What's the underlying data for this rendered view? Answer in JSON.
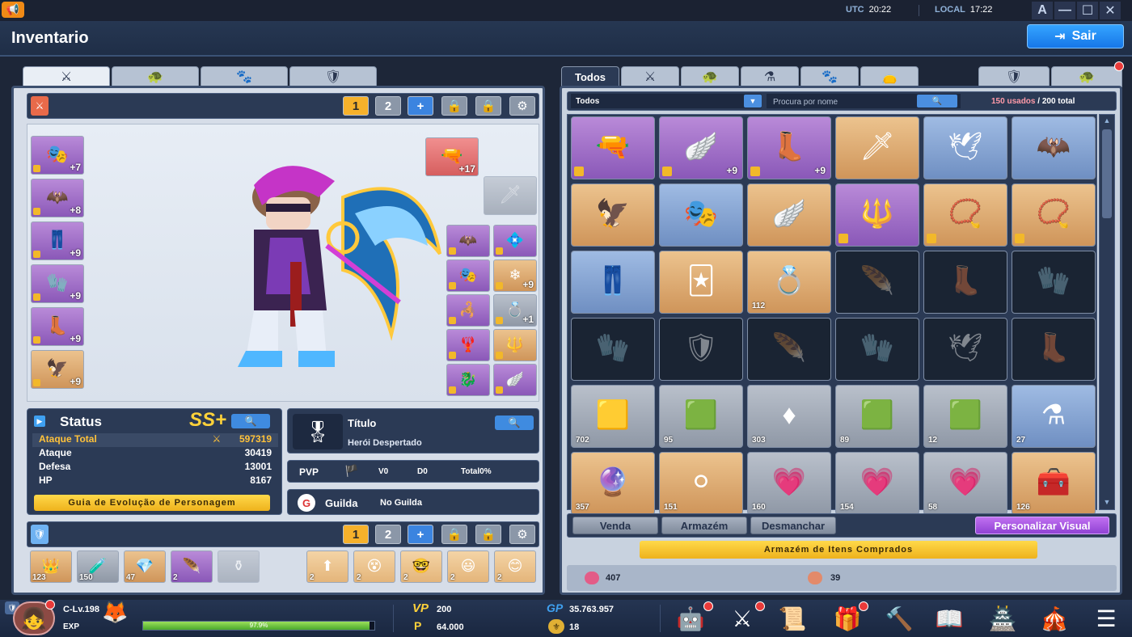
{
  "system": {
    "utc_label": "UTC",
    "utc_time": "20:22",
    "local_label": "LOCAL",
    "local_time": "17:22",
    "font_btn": "A",
    "min_btn": "—",
    "max_btn": "☐",
    "close_btn": "✕"
  },
  "header": {
    "title": "Inventario",
    "exit_label": "Sair"
  },
  "left": {
    "tabs": [
      "sword-icon",
      "armor-icon",
      "paw-icon",
      "shield-icon"
    ],
    "pages": [
      "1",
      "2"
    ],
    "add": "+",
    "left_slots": [
      {
        "lv": "+7",
        "tint": "purple",
        "icon": "🎭"
      },
      {
        "lv": "+8",
        "tint": "purple",
        "icon": "🦇"
      },
      {
        "lv": "+9",
        "tint": "purple",
        "icon": "👖"
      },
      {
        "lv": "+9",
        "tint": "purple",
        "icon": "🧤"
      },
      {
        "lv": "+9",
        "tint": "purple",
        "icon": "👢"
      },
      {
        "lv": "+9",
        "tint": "orange",
        "icon": "🦅"
      }
    ],
    "weapon_lv": "+17",
    "right_slots": [
      {
        "lv": "",
        "tint": "purple",
        "icon": "🦇"
      },
      {
        "lv": "",
        "tint": "purple",
        "icon": "💠"
      },
      {
        "lv": "",
        "tint": "purple",
        "icon": "🎭"
      },
      {
        "lv": "+9",
        "tint": "orange",
        "icon": "❄"
      },
      {
        "lv": "",
        "tint": "purple",
        "icon": "🦂"
      },
      {
        "lv": "+1",
        "tint": "gray",
        "icon": "💍"
      },
      {
        "lv": "",
        "tint": "purple",
        "icon": "🦞"
      },
      {
        "lv": "",
        "tint": "orange",
        "icon": "🔱"
      },
      {
        "lv": "",
        "tint": "purple",
        "icon": "🐉"
      },
      {
        "lv": "",
        "tint": "purple",
        "icon": "🪽"
      }
    ],
    "status": {
      "title": "Status",
      "grade": "SS+",
      "rows": [
        {
          "label": "Ataque Total",
          "value": "597319"
        },
        {
          "label": "Ataque",
          "value": "30419"
        },
        {
          "label": "Defesa",
          "value": "13001"
        },
        {
          "label": "HP",
          "value": "8167"
        }
      ],
      "guide_btn": "Guia de Evolução de Personagem"
    },
    "title_box": {
      "label": "Título",
      "value": "Herói Despertado"
    },
    "pvp": {
      "label": "PVP",
      "v": "V0",
      "d": "D0",
      "total": "Total0%"
    },
    "guild": {
      "label": "Guilda",
      "value": "No Guilda"
    },
    "quick_items": [
      {
        "count": "123",
        "tint": "orange",
        "icon": "👑"
      },
      {
        "count": "150",
        "tint": "gray",
        "icon": "🧪"
      },
      {
        "count": "47",
        "tint": "orange",
        "icon": "💎"
      },
      {
        "count": "2",
        "tint": "purple",
        "icon": "🪶"
      }
    ],
    "emotes": [
      {
        "count": "2",
        "icon": "⬆"
      },
      {
        "count": "2",
        "icon": "😵"
      },
      {
        "count": "2",
        "icon": "🤓"
      },
      {
        "count": "2",
        "icon": "😃"
      },
      {
        "count": "2",
        "icon": "😊"
      }
    ]
  },
  "right": {
    "tab_all": "Todos",
    "filter": "Todos",
    "search_placeholder": "Procura por nome",
    "used": "150 usados",
    "total": "/ 200 total",
    "grid": [
      {
        "tint": "purple",
        "icon": "🔫",
        "lock": true,
        "plus": "",
        "cnt": ""
      },
      {
        "tint": "purple",
        "icon": "🪽",
        "lock": true,
        "plus": "+9",
        "cnt": ""
      },
      {
        "tint": "purple",
        "icon": "👢",
        "lock": true,
        "plus": "+9",
        "cnt": ""
      },
      {
        "tint": "orange",
        "icon": "🗡",
        "lock": false,
        "plus": "",
        "cnt": ""
      },
      {
        "tint": "blue",
        "icon": "🕊",
        "lock": false,
        "plus": "",
        "cnt": ""
      },
      {
        "tint": "blue",
        "icon": "🦇",
        "lock": false,
        "plus": "",
        "cnt": ""
      },
      {
        "tint": "orange",
        "icon": "🦅",
        "lock": false,
        "plus": "",
        "cnt": ""
      },
      {
        "tint": "blue",
        "icon": "🎭",
        "lock": false,
        "plus": "",
        "cnt": ""
      },
      {
        "tint": "orange",
        "icon": "🪽",
        "lock": false,
        "plus": "",
        "cnt": ""
      },
      {
        "tint": "purple",
        "icon": "🔱",
        "lock": true,
        "plus": "",
        "cnt": ""
      },
      {
        "tint": "orange",
        "icon": "📿",
        "lock": true,
        "plus": "",
        "cnt": ""
      },
      {
        "tint": "orange",
        "icon": "📿",
        "lock": true,
        "plus": "",
        "cnt": ""
      },
      {
        "tint": "blue",
        "icon": "👖",
        "lock": false,
        "plus": "",
        "cnt": ""
      },
      {
        "tint": "orange",
        "icon": "🃏",
        "lock": false,
        "plus": "",
        "cnt": ""
      },
      {
        "tint": "orange",
        "icon": "💍",
        "lock": false,
        "plus": "",
        "cnt": "112"
      },
      {
        "tint": "dark",
        "icon": "🪶",
        "lock": false,
        "plus": "",
        "cnt": ""
      },
      {
        "tint": "dark",
        "icon": "👢",
        "lock": false,
        "plus": "",
        "cnt": ""
      },
      {
        "tint": "dark",
        "icon": "🧤",
        "lock": false,
        "plus": "",
        "cnt": ""
      },
      {
        "tint": "dark",
        "icon": "🧤",
        "lock": false,
        "plus": "",
        "cnt": ""
      },
      {
        "tint": "dark",
        "icon": "🛡",
        "lock": false,
        "plus": "",
        "cnt": ""
      },
      {
        "tint": "dark",
        "icon": "🪶",
        "lock": false,
        "plus": "",
        "cnt": ""
      },
      {
        "tint": "dark",
        "icon": "🧤",
        "lock": false,
        "plus": "",
        "cnt": ""
      },
      {
        "tint": "dark",
        "icon": "🕊",
        "lock": false,
        "plus": "",
        "cnt": ""
      },
      {
        "tint": "dark",
        "icon": "👢",
        "lock": false,
        "plus": "",
        "cnt": ""
      },
      {
        "tint": "gray",
        "icon": "🟨",
        "lock": false,
        "plus": "",
        "cnt": "702"
      },
      {
        "tint": "gray",
        "icon": "🟩",
        "lock": false,
        "plus": "",
        "cnt": "95"
      },
      {
        "tint": "gray",
        "icon": "♦",
        "lock": false,
        "plus": "",
        "cnt": "303"
      },
      {
        "tint": "gray",
        "icon": "🟩",
        "lock": false,
        "plus": "",
        "cnt": "89"
      },
      {
        "tint": "gray",
        "icon": "🟩",
        "lock": false,
        "plus": "",
        "cnt": "12"
      },
      {
        "tint": "blue",
        "icon": "⚗",
        "lock": false,
        "plus": "",
        "cnt": "27"
      },
      {
        "tint": "orange",
        "icon": "🔮",
        "lock": false,
        "plus": "",
        "cnt": "357"
      },
      {
        "tint": "orange",
        "icon": "⚪",
        "lock": false,
        "plus": "",
        "cnt": "151"
      },
      {
        "tint": "gray",
        "icon": "💗",
        "lock": false,
        "plus": "",
        "cnt": "160"
      },
      {
        "tint": "gray",
        "icon": "💗",
        "lock": false,
        "plus": "",
        "cnt": "154"
      },
      {
        "tint": "gray",
        "icon": "💗",
        "lock": false,
        "plus": "",
        "cnt": "58"
      },
      {
        "tint": "orange",
        "icon": "🧰",
        "lock": false,
        "plus": "",
        "cnt": "126"
      }
    ],
    "actions": {
      "sell": "Venda",
      "storage": "Armazém",
      "dismantle": "Desmanchar",
      "visual": "Personalizar Visual"
    },
    "purchased_btn": "Armazém de Itens Comprados",
    "currency1": "407",
    "currency2": "39"
  },
  "bottom": {
    "level": "C-Lv.198",
    "exp_label": "EXP",
    "exp_pct": 0.979,
    "exp_text": "97.9%",
    "vp_label": "VP",
    "vp": "200",
    "p_label": "P",
    "p": "64.000",
    "gp_label": "GP",
    "gp": "35.763.957",
    "crest": "18"
  }
}
